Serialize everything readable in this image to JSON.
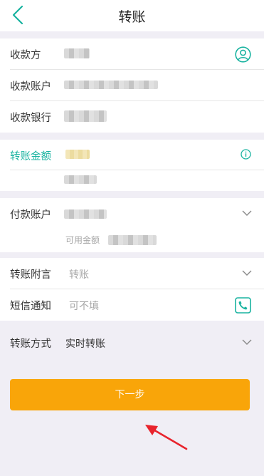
{
  "header": {
    "title": "转账"
  },
  "payee_section": {
    "payee_label": "收款方",
    "account_label": "收款账户",
    "bank_label": "收款银行"
  },
  "amount_section": {
    "amount_label": "转账金额"
  },
  "payer_section": {
    "account_label": "付款账户",
    "available_label": "可用金额"
  },
  "options_section": {
    "remark_label": "转账附言",
    "remark_placeholder": "转账",
    "sms_label": "短信通知",
    "sms_placeholder": "可不填",
    "method_label": "转账方式",
    "method_value": "实时转账"
  },
  "actions": {
    "next_label": "下一步"
  },
  "icons": {
    "back": "back-chevron-icon",
    "contacts": "person-circle-icon",
    "info": "info-icon",
    "phone": "phone-icon",
    "dropdown": "chevron-down-icon",
    "annotation": "red-arrow-icon"
  },
  "colors": {
    "accent": "#19b3a0",
    "button": "#f9a509",
    "background": "#f0eef5",
    "annotation": "#e8232c"
  }
}
